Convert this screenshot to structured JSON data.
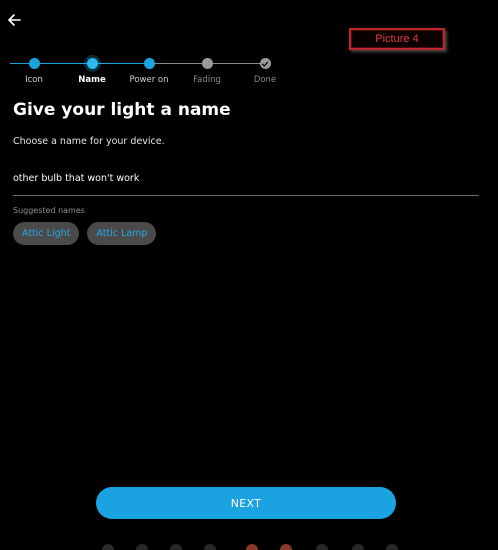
{
  "header": {
    "back_icon": "arrow-left-icon",
    "picture_label": "Picture 4"
  },
  "stepper": {
    "steps": [
      {
        "label": "Icon",
        "state": "done"
      },
      {
        "label": "Name",
        "state": "current"
      },
      {
        "label": "Power on",
        "state": "done"
      },
      {
        "label": "Fading",
        "state": "pending"
      },
      {
        "label": "Done",
        "state": "pending",
        "icon": "check-icon"
      }
    ]
  },
  "main": {
    "title": "Give your light a name",
    "subtitle": "Choose a name for your device.",
    "name_value": "other bulb that won't work",
    "suggested_label": "Suggested names",
    "suggestions": [
      "Attic Light",
      "Attic Lamp"
    ]
  },
  "footer": {
    "next_label": "NEXT"
  },
  "colors": {
    "accent": "#1aa3e0",
    "chip_bg": "#4a4a4a",
    "background": "#000000"
  }
}
